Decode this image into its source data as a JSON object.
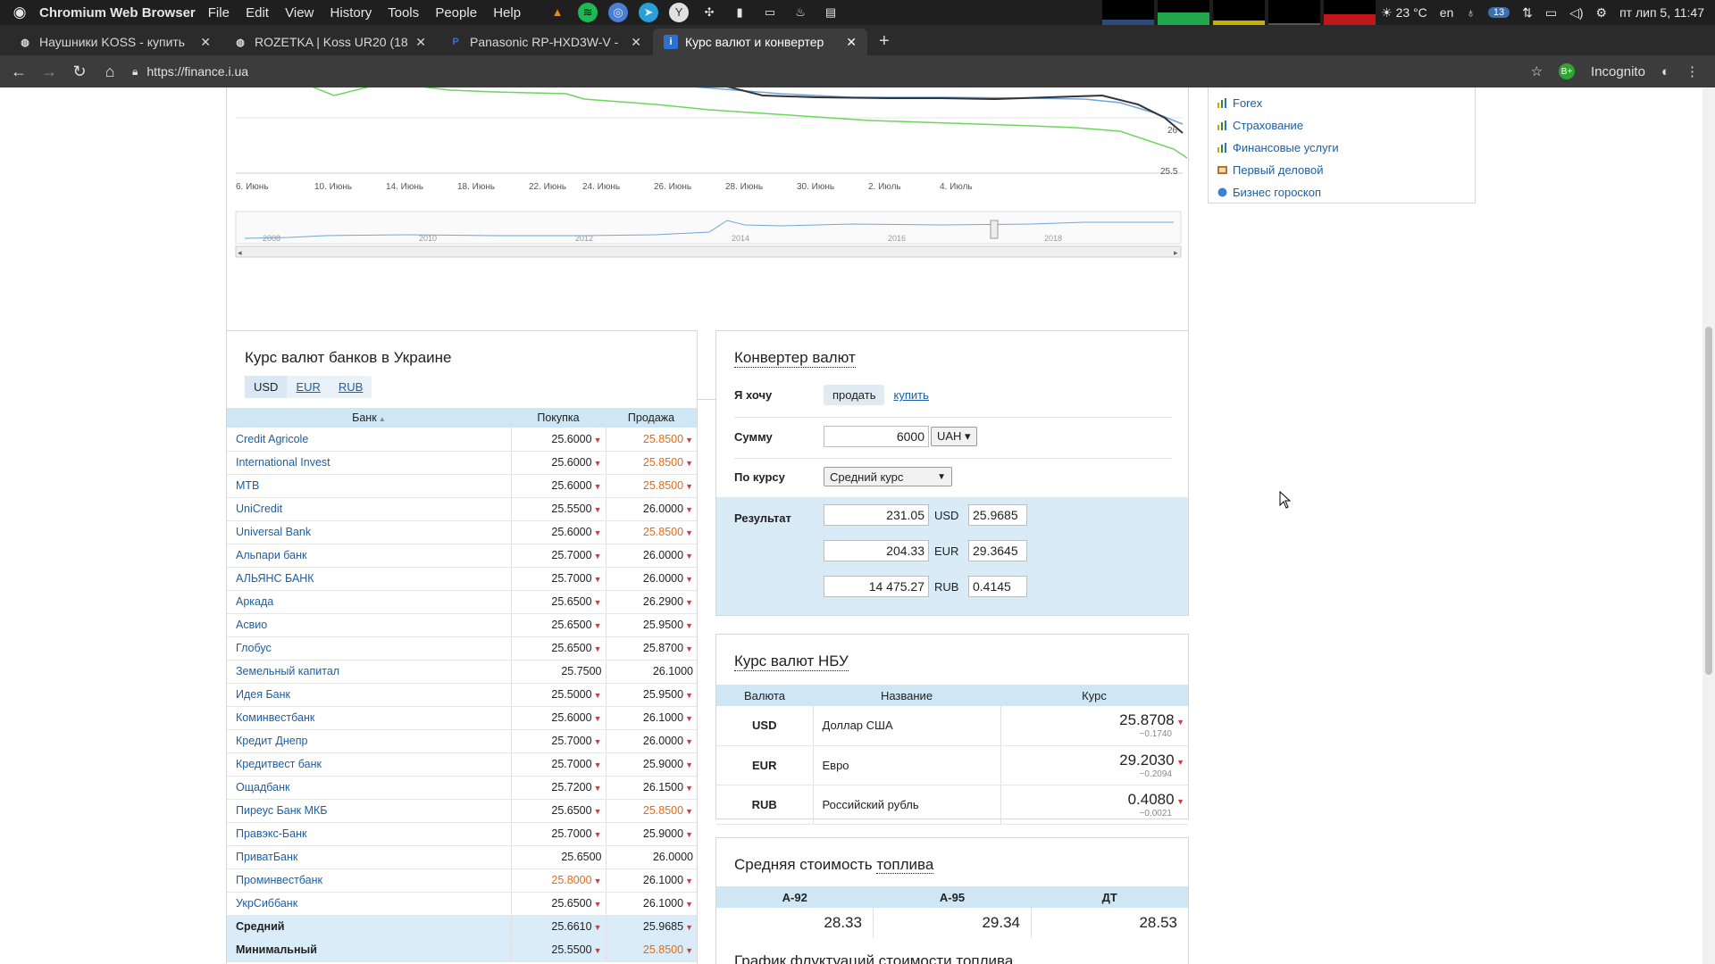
{
  "os": {
    "app_name": "Chromium Web Browser",
    "menu": [
      "File",
      "Edit",
      "View",
      "History",
      "Tools",
      "People",
      "Help"
    ],
    "temperature": "23 °C",
    "lang": "en",
    "badge_count": "13",
    "datetime": "пт лип 5, 11:47"
  },
  "tabs": [
    {
      "title": "Наушники KOSS - купить",
      "icon": "globe-icon"
    },
    {
      "title": "ROZETKA | Koss UR20 (18",
      "icon": "globe-icon"
    },
    {
      "title": "Panasonic RP-HXD3W-V -",
      "icon": "p-icon"
    },
    {
      "title": "Курс валют и конвертер",
      "icon": "info-icon"
    }
  ],
  "address": {
    "url": "https://finance.i.ua",
    "profile": "Incognito"
  },
  "chart": {
    "x_ticks": [
      "6. Июнь",
      "10. Июнь",
      "14. Июнь",
      "18. Июнь",
      "22. Июнь",
      "24. Июнь",
      "26. Июнь",
      "28. Июнь",
      "30. Июнь",
      "2. Июль",
      "4. Июль"
    ],
    "y_labels": [
      "26",
      "25.5"
    ],
    "navigator_years": [
      "2008",
      "2010",
      "2012",
      "2014",
      "2016",
      "2018"
    ]
  },
  "sidebar": {
    "links": [
      "Forex",
      "Страхование",
      "Финансовые услуги",
      "Первый деловой",
      "Бизнес гороскоп"
    ]
  },
  "banks": {
    "title": "Курс валют банков в Украине",
    "currencies": [
      "USD",
      "EUR",
      "RUB"
    ],
    "headers": {
      "bank": "Банк",
      "buy": "Покупка",
      "sell": "Продажа"
    },
    "rows": [
      {
        "bank": "Credit Agricole",
        "buy": "25.6000",
        "sell": "25.8500",
        "sell_hl": true
      },
      {
        "bank": "International Invest",
        "buy": "25.6000",
        "sell": "25.8500",
        "sell_hl": true
      },
      {
        "bank": "MTB",
        "buy": "25.6000",
        "sell": "25.8500",
        "sell_hl": true
      },
      {
        "bank": "UniCredit",
        "buy": "25.5500",
        "sell": "26.0000",
        "sell_hl": false
      },
      {
        "bank": "Universal Bank",
        "buy": "25.6000",
        "sell": "25.8500",
        "sell_hl": true
      },
      {
        "bank": "Альпари банк",
        "buy": "25.7000",
        "sell": "26.0000",
        "sell_hl": false
      },
      {
        "bank": "АЛЬЯНС БАНК",
        "buy": "25.7000",
        "sell": "26.0000",
        "sell_hl": false
      },
      {
        "bank": "Аркада",
        "buy": "25.6500",
        "sell": "26.2900",
        "sell_hl": false
      },
      {
        "bank": "Асвио",
        "buy": "25.6500",
        "sell": "25.9500",
        "sell_hl": false
      },
      {
        "bank": "Глобус",
        "buy": "25.6500",
        "sell": "25.8700",
        "sell_hl": false
      },
      {
        "bank": "Земельный капитал",
        "buy": "25.7500",
        "sell": "26.1000",
        "sell_hl": false,
        "noarrow": true
      },
      {
        "bank": "Идея Банк",
        "buy": "25.5000",
        "sell": "25.9500",
        "sell_hl": false
      },
      {
        "bank": "Коминвестбанк",
        "buy": "25.6000",
        "sell": "26.1000",
        "sell_hl": false
      },
      {
        "bank": "Кредит Днепр",
        "buy": "25.7000",
        "sell": "26.0000",
        "sell_hl": false
      },
      {
        "bank": "Кредитвест банк",
        "buy": "25.7000",
        "sell": "25.9000",
        "sell_hl": false
      },
      {
        "bank": "Ощадбанк",
        "buy": "25.7200",
        "sell": "26.1500",
        "sell_hl": false
      },
      {
        "bank": "Пиреус Банк МКБ",
        "buy": "25.6500",
        "sell": "25.8500",
        "sell_hl": true
      },
      {
        "bank": "Правэкс-Банк",
        "buy": "25.7000",
        "sell": "25.9000",
        "sell_hl": false
      },
      {
        "bank": "ПриватБанк",
        "buy": "25.6500",
        "sell": "26.0000",
        "sell_hl": false,
        "noarrow": true
      },
      {
        "bank": "Проминвестбанк",
        "buy": "25.8000",
        "sell": "26.1000",
        "sell_hl": false,
        "buy_hl": true
      },
      {
        "bank": "УкрСиббанк",
        "buy": "25.6500",
        "sell": "26.1000",
        "sell_hl": false
      }
    ],
    "summary": [
      {
        "bank": "Средний",
        "buy": "25.6610",
        "sell": "25.9685",
        "sell_hl": false
      },
      {
        "bank": "Минимальный",
        "buy": "25.5500",
        "sell": "25.8500",
        "sell_hl": true
      }
    ]
  },
  "converter": {
    "title": "Конвертер валют",
    "want_label": "Я хочу",
    "sell": "продать",
    "buy": "купить",
    "sum_label": "Сумму",
    "amount": "6000",
    "amount_currency": "UAH ▾",
    "rate_label": "По курсу",
    "rate_type": "Средний курс",
    "result_label": "Результат",
    "results": [
      {
        "value": "231.05",
        "currency": "USD",
        "rate": "25.9685"
      },
      {
        "value": "204.33",
        "currency": "EUR",
        "rate": "29.3645"
      },
      {
        "value": "14 475.27",
        "currency": "RUB",
        "rate": "0.4145"
      }
    ]
  },
  "nbu": {
    "title": "Курс валют НБУ",
    "headers": {
      "code": "Валюта",
      "name": "Название",
      "rate": "Курс"
    },
    "rows": [
      {
        "code": "USD",
        "name": "Доллар США",
        "rate": "25.8708",
        "change": "−0.1740"
      },
      {
        "code": "EUR",
        "name": "Евро",
        "rate": "29.2030",
        "change": "−0.2094"
      },
      {
        "code": "RUB",
        "name": "Российский рубль",
        "rate": "0.4080",
        "change": "−0.0021"
      }
    ]
  },
  "fuel": {
    "title_pre": "Средняя стоимость ",
    "title_link": "топлива",
    "headers": [
      "А-92",
      "А-95",
      "ДТ"
    ],
    "values": [
      "28.33",
      "29.34",
      "28.53"
    ],
    "next_title": "График флуктуаций стоимости топлива"
  },
  "colors": {
    "accent": "#1a5fa8",
    "table_header": "#cfe6f4",
    "highlight": "#e36c12",
    "down_arrow": "#d23b3b"
  }
}
